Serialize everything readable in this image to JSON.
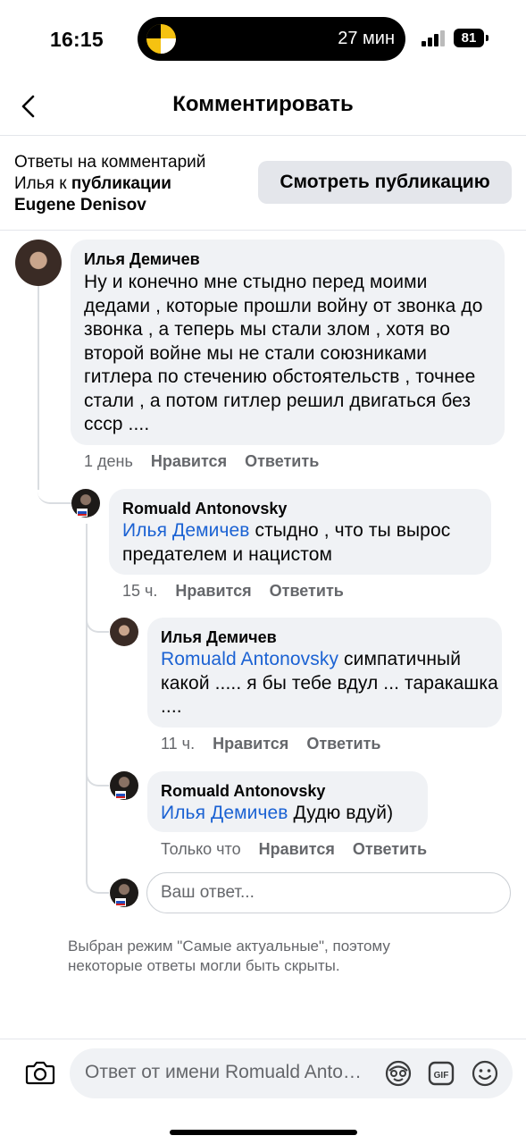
{
  "status_bar": {
    "time": "16:15",
    "activity_text": "27 мин",
    "battery": "81"
  },
  "header": {
    "title": "Комментировать",
    "back_icon": "chevron-left-icon"
  },
  "context": {
    "line1": "Ответы на комментарий",
    "line2_prefix": "Илья к ",
    "line2_bold": "публикации",
    "line3_bold": "Eugene Denisov",
    "view_post_label": "Смотреть публикацию"
  },
  "comments": [
    {
      "author": "Илья Демичев",
      "mention": "",
      "text": "Ну и конечно мне стыдно перед моими дедами , которые прошли войну от звонка до звонка , а теперь мы стали злом , хотя во второй войне мы не стали союзниками гитлера по стечению обстоятельств , точнее стали , а потом гитлер решил двигаться без ссср ....",
      "time": "1 день",
      "like": "Нравится",
      "reply": "Ответить"
    },
    {
      "author": "Romuald Antonovsky",
      "mention": "Илья Демичев",
      "text": " стыдно , что ты вырос предателем и нацистом",
      "time": "15 ч.",
      "like": "Нравится",
      "reply": "Ответить"
    },
    {
      "author": "Илья Демичев",
      "mention": "Romuald Antonovsky",
      "text": " симпатичный какой ..... я бы тебе вдул ... таракашка ....",
      "time": "11 ч.",
      "like": "Нравится",
      "reply": "Ответить"
    },
    {
      "author": "Romuald Antonovsky",
      "mention": "Илья Демичев",
      "text": " Дудю вдуй)",
      "time": "Только что",
      "like": "Нравится",
      "reply": "Ответить"
    }
  ],
  "reply_input": {
    "placeholder": "Ваш ответ..."
  },
  "note": "Выбран режим \"Самые актуальные\", поэтому некоторые ответы могли быть скрыты.",
  "composer": {
    "placeholder": "Ответ от имени Romuald Antonovsky",
    "camera_icon": "camera-icon",
    "avatar_icon": "avatar-sticker-icon",
    "gif_icon": "gif-icon",
    "emoji_icon": "emoji-icon"
  },
  "colors": {
    "mention": "#1b62d3",
    "bubble": "#f0f2f5",
    "meta": "#65676b"
  }
}
